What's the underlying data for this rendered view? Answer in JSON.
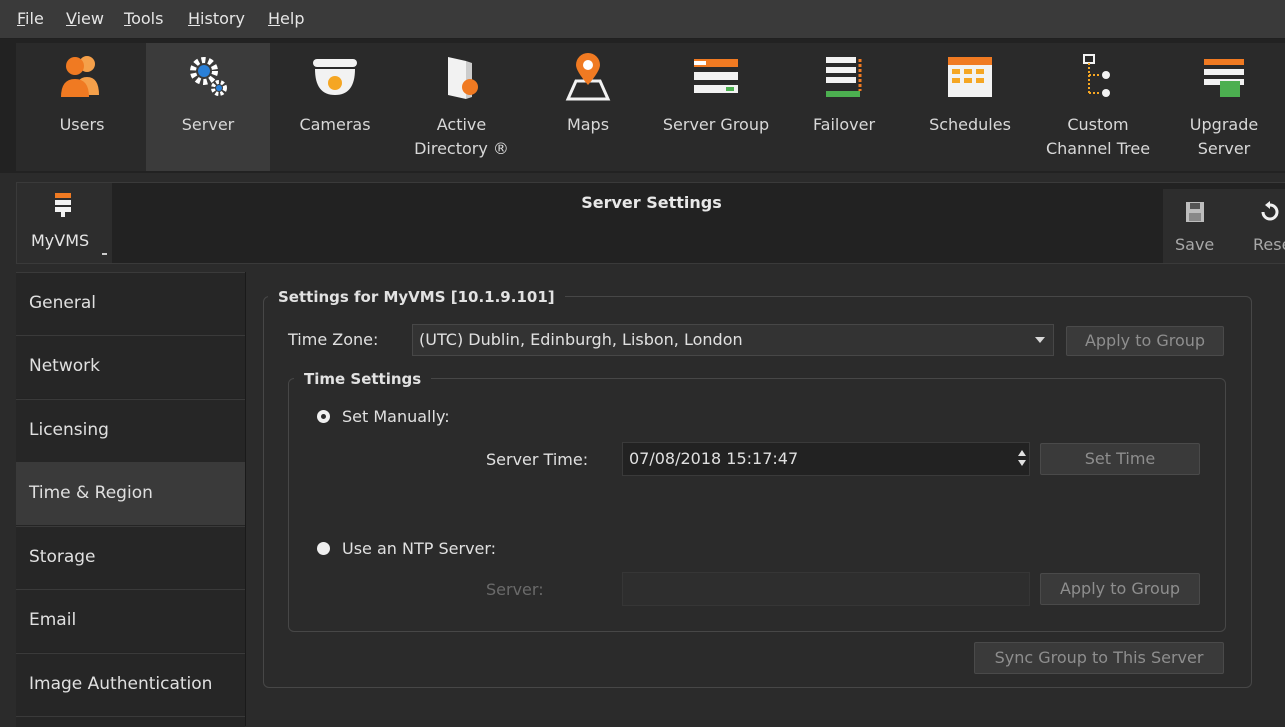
{
  "menu": [
    {
      "label": "File",
      "mnemonic": "F",
      "rest": "ile"
    },
    {
      "label": "View",
      "mnemonic": "V",
      "rest": "iew"
    },
    {
      "label": "Tools",
      "mnemonic": "T",
      "rest": "ools"
    },
    {
      "label": "History",
      "mnemonic": "H",
      "rest": "istory"
    },
    {
      "label": "Help",
      "mnemonic": "H",
      "rest": "elp"
    }
  ],
  "toolbar": {
    "items": [
      {
        "label": "Users",
        "icon": "users-icon"
      },
      {
        "label": "Server",
        "icon": "server-gear-icon",
        "active": true
      },
      {
        "label": "Cameras",
        "icon": "dome-camera-icon"
      },
      {
        "label": "Active\nDirectory ®",
        "icon": "active-directory-icon"
      },
      {
        "label": "Maps",
        "icon": "map-pin-icon"
      },
      {
        "label": "Server Group",
        "icon": "server-group-icon"
      },
      {
        "label": "Failover",
        "icon": "failover-icon"
      },
      {
        "label": "Schedules",
        "icon": "calendar-icon"
      },
      {
        "label": "Custom\nChannel Tree",
        "icon": "channel-tree-icon"
      },
      {
        "label": "Upgrade\nServer",
        "icon": "upgrade-server-icon"
      }
    ]
  },
  "header": {
    "server_name": "MyVMS",
    "title": "Server Settings",
    "save_label": "Save",
    "reset_label": "Reset"
  },
  "sidebar": {
    "items": [
      {
        "label": "General"
      },
      {
        "label": "Network"
      },
      {
        "label": "Licensing"
      },
      {
        "label": "Time & Region",
        "active": true
      },
      {
        "label": "Storage"
      },
      {
        "label": "Email"
      },
      {
        "label": "Image Authentication"
      }
    ]
  },
  "settings": {
    "group_title": "Settings for MyVMS [10.1.9.101]",
    "timezone_label": "Time Zone:",
    "timezone_value": "(UTC) Dublin, Edinburgh, Lisbon, London",
    "apply_group_tz": "Apply to Group",
    "time_settings_title": "Time Settings",
    "set_manually_label": "Set Manually:",
    "server_time_label": "Server Time:",
    "server_time_value": "07/08/2018 15:17:47",
    "set_time_button": "Set Time",
    "ntp_label": "Use an NTP Server:",
    "server_label": "Server:",
    "server_value": "",
    "apply_group_ntp": "Apply to Group",
    "sync_button": "Sync Group to This Server"
  },
  "colors": {
    "accent_orange": "#f07a22",
    "background": "#2b2b2b"
  }
}
